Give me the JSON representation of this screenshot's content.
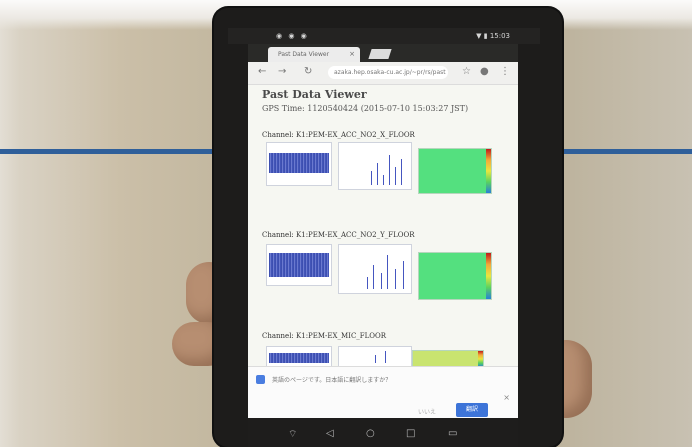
{
  "device_status": {
    "left_icons": "◉ ◉ ◉",
    "clock": "▼ ▮ 15:03"
  },
  "browser": {
    "tab_title": "Past Data Viewer",
    "url": "azaka.hep.osaka-cu.ac.jp/~pr/rs/past"
  },
  "page": {
    "title": "Past Data Viewer",
    "gps_time": "GPS Time: 1120540424 (2015-07-10 15:03:27 JST)",
    "channels": [
      {
        "label": "Channel: K1:PEM-EX_ACC_NO2_X_FLOOR"
      },
      {
        "label": "Channel: K1:PEM-EX_ACC_NO2_Y_FLOOR"
      },
      {
        "label": "Channel: K1:PEM-EX_MIC_FLOOR"
      }
    ]
  },
  "translate_bar": {
    "message": "英語のページです。日本語に翻訳しますか？",
    "decline": "いいえ",
    "accept": "翻訳"
  },
  "colors": {
    "stripe": "#2f5f9a",
    "plot_trace": "#3d4fb0",
    "spectrogram": "#54e07f",
    "accept_button": "#3d74d8"
  }
}
